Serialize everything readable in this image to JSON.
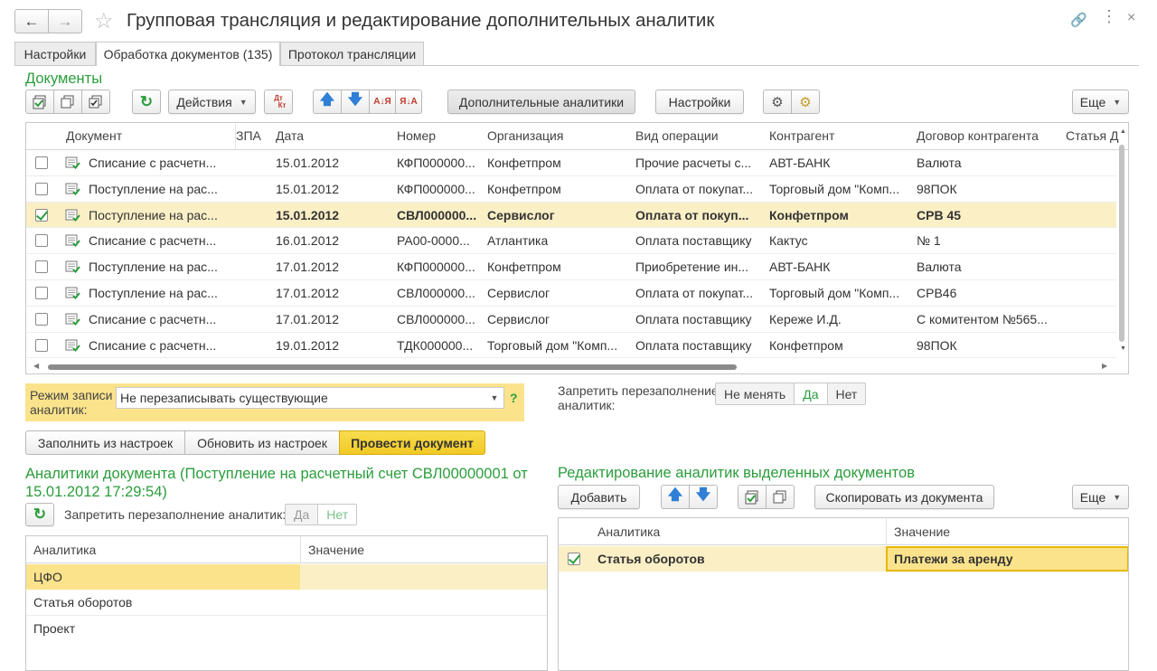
{
  "window": {
    "title": "Групповая трансляция и редактирование дополнительных аналитик"
  },
  "tabs": [
    "Настройки",
    "Обработка документов (135)",
    "Протокол трансляции"
  ],
  "docs": {
    "section_title": "Документы",
    "toolbar": {
      "actions": "Действия",
      "dt_kt_top": "Дт",
      "dt_kt_bottom": "Кт",
      "az": "А↓Я",
      "za": "Я↓А",
      "extra_analytics": "Дополнительные аналитики",
      "settings": "Настройки",
      "more": "Еще"
    },
    "columns": [
      "Документ",
      "ЗПА",
      "Дата",
      "Номер",
      "Организация",
      "Вид операции",
      "Контрагент",
      "Договор контрагента",
      "Статья Д"
    ],
    "rows": [
      {
        "checked": false,
        "doc": "Списание с расчетн...",
        "date": "15.01.2012",
        "num": "КФП000000...",
        "org": "Конфетпром",
        "op": "Прочие расчеты с...",
        "contr": "АВТ-БАНК",
        "contract": "Валюта"
      },
      {
        "checked": false,
        "doc": "Поступление на рас...",
        "date": "15.01.2012",
        "num": "КФП000000...",
        "org": "Конфетпром",
        "op": "Оплата от покупат...",
        "contr": "Торговый дом \"Комп...",
        "contract": "98ПОК"
      },
      {
        "checked": true,
        "doc": "Поступление на рас...",
        "date": "15.01.2012",
        "num": "СВЛ000000...",
        "org": "Сервислог",
        "op": "Оплата от покуп...",
        "contr": "Конфетпром",
        "contract": "СРВ 45",
        "selected": true
      },
      {
        "checked": false,
        "doc": "Списание с расчетн...",
        "date": "16.01.2012",
        "num": "РА00-0000...",
        "org": "Атлантика",
        "op": "Оплата поставщику",
        "contr": "Кактус",
        "contract": "№ 1"
      },
      {
        "checked": false,
        "doc": "Поступление на рас...",
        "date": "17.01.2012",
        "num": "КФП000000...",
        "org": "Конфетпром",
        "op": "Приобретение ин...",
        "contr": "АВТ-БАНК",
        "contract": "Валюта"
      },
      {
        "checked": false,
        "doc": "Поступление на рас...",
        "date": "17.01.2012",
        "num": "СВЛ000000...",
        "org": "Сервислог",
        "op": "Оплата от покупат...",
        "contr": "Торговый дом \"Комп...",
        "contract": "СРВ46"
      },
      {
        "checked": false,
        "doc": "Списание с расчетн...",
        "date": "17.01.2012",
        "num": "СВЛ000000...",
        "org": "Сервислог",
        "op": "Оплата поставщику",
        "contr": "Кереже И.Д.",
        "contract": "С комитентом №565..."
      },
      {
        "checked": false,
        "doc": "Списание с расчетн...",
        "date": "19.01.2012",
        "num": "ТДК000000...",
        "org": "Торговый дом \"Комп...",
        "op": "Оплата поставщику",
        "contr": "Конфетпром",
        "contract": "98ПОК"
      }
    ]
  },
  "mode": {
    "label": "Режим записи аналитик:",
    "value": "Не перезаписывать существующие",
    "help": "?"
  },
  "forbid": {
    "label": "Запретить перезаполнение аналитик:",
    "options": [
      "Не менять",
      "Да",
      "Нет"
    ]
  },
  "buttons": {
    "fill": "Заполнить из настроек",
    "update": "Обновить из настроек",
    "post": "Провести документ"
  },
  "left": {
    "title": "Аналитики документа (Поступление на расчетный счет СВЛ00000001 от 15.01.2012 17:29:54)",
    "forbid_label": "Запретить перезаполнение аналитик:",
    "yes": "Да",
    "no": "Нет",
    "columns": [
      "Аналитика",
      "Значение"
    ],
    "rows": [
      "ЦФО",
      "Статья оборотов",
      "Проект"
    ]
  },
  "right": {
    "title": "Редактирование аналитик выделенных документов",
    "add": "Добавить",
    "copy": "Скопировать из документа",
    "more": "Еще",
    "columns": [
      "Аналитика",
      "Значение"
    ],
    "rows": [
      {
        "checked": true,
        "name": "Статья оборотов",
        "value": "Платежи за аренду"
      }
    ]
  },
  "colors": {
    "accent": "#2b9d3c",
    "selection": "#fbefc6",
    "highlight_yellow": "#fbe38c",
    "post_button": "#f5d334"
  }
}
